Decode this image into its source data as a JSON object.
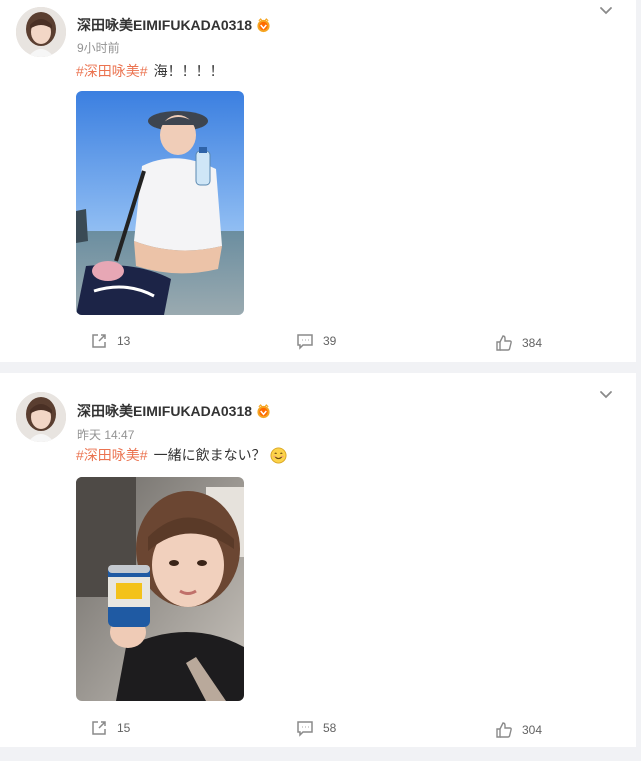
{
  "posts": [
    {
      "username": "深田咏美EIMIFUKADA0318",
      "time": "9小时前",
      "hashtag": "#深田咏美#",
      "text": "海！！！！",
      "has_emoji": false,
      "stats": {
        "shares": "13",
        "comments": "39",
        "likes": "384"
      },
      "photo_desc": "woman-at-sea-with-water-bottle"
    },
    {
      "username": "深田咏美EIMIFUKADA0318",
      "time": "昨天 14:47",
      "hashtag": "#深田咏美#",
      "text": "一緒に飲まない？",
      "has_emoji": true,
      "stats": {
        "shares": "15",
        "comments": "58",
        "likes": "304"
      },
      "photo_desc": "woman-holding-beer-can"
    }
  ],
  "colors": {
    "hashtag": "#eb7350",
    "background": "#f1f2f5",
    "card": "#ffffff",
    "meta_text": "#939393"
  }
}
